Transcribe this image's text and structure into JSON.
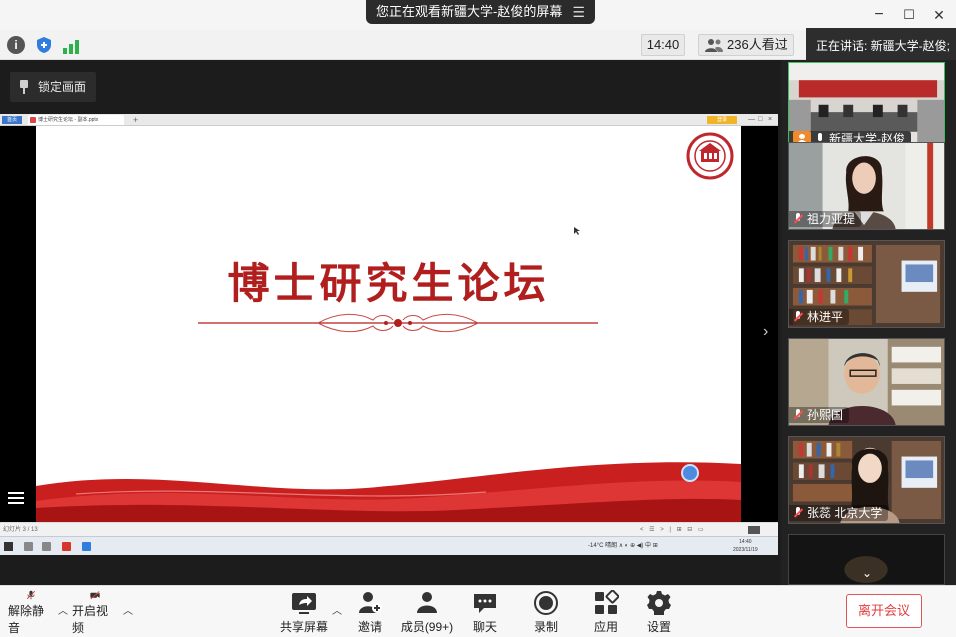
{
  "window": {
    "share_banner": "您正在观看新疆大学-赵俊的屏幕",
    "controls": {
      "minimize": "−",
      "maximize": "☐",
      "close": "✕"
    }
  },
  "infobar": {
    "time": "14:40",
    "viewers": "236人看过",
    "speaking": "正在讲话: 新疆大学-赵俊;"
  },
  "share": {
    "lock_label": "锁定画面",
    "slide_title": "博士研究生论坛",
    "browser_tab_short": "首页",
    "browser_tab": "博士研究生论坛 - 副本.pptx",
    "browser_plus": "+",
    "browser_tag": "登录",
    "ppt_page": "幻灯片 3 / 13",
    "ppt_controls": "< ☰ > | ⊞ ⊟ ▭",
    "tray_text": "-14°C 晴朗 ∧ ◐ ⊕ ◀) 中 ⊞",
    "clock_time": "14:40",
    "clock_date": "2023/11/19"
  },
  "participants": [
    {
      "name": "新疆大学-赵俊",
      "mic": "on",
      "active": true
    },
    {
      "name": "祖力亚提",
      "mic": "off",
      "active": false
    },
    {
      "name": "林进平",
      "mic": "off",
      "active": false
    },
    {
      "name": "孙熙国",
      "mic": "off",
      "active": false
    },
    {
      "name": "张蕊 北京大学",
      "mic": "off",
      "active": false
    }
  ],
  "toolbar": {
    "unmute": "解除静音",
    "start_video": "开启视频",
    "share_screen": "共享屏幕",
    "invite": "邀请",
    "members": "成员(99+)",
    "chat": "聊天",
    "record": "录制",
    "apps": "应用",
    "settings": "设置",
    "leave": "离开会议"
  },
  "colors": {
    "accent_red": "#b01e1e",
    "active_border": "#3fbf5c",
    "leave_red": "#e03e3e"
  }
}
